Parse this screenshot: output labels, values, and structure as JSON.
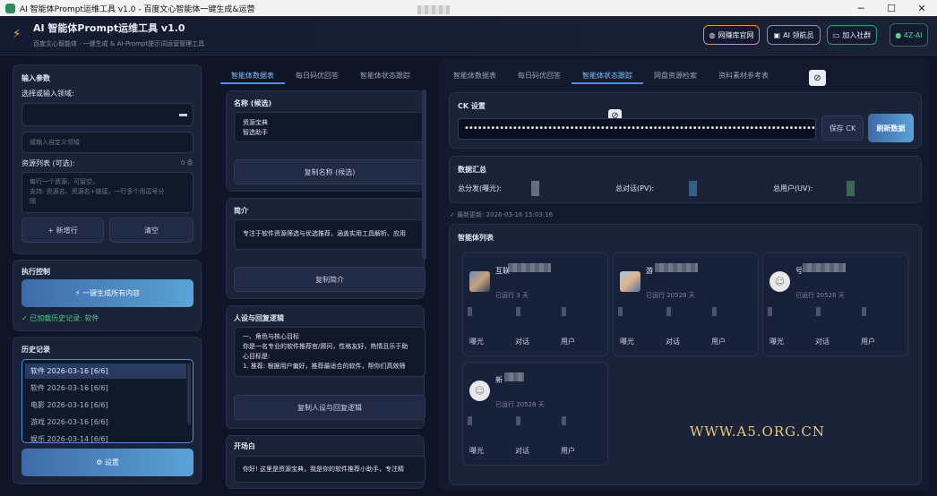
{
  "window": {
    "title": "AI 智能体Prompt运维工具 v1.0 - 百度文心智能体一键生成&运营",
    "minimize": "─",
    "maximize": "☐",
    "close": "✕"
  },
  "header": {
    "icon": "bolt-icon",
    "title": "AI 智能体Prompt运维工具 v1.0",
    "subtitle": "百度文心智能体 · 一键生成 & AI-Prompt提示词运营管理工具",
    "buttons": [
      {
        "label": "网赚库官网",
        "icon": "globe-icon"
      },
      {
        "label": "AI 领航员",
        "icon": "robot-icon"
      },
      {
        "label": "加入社群",
        "icon": "chat-icon"
      },
      {
        "label": "● 4Z-AI"
      }
    ],
    "accent_colors": {
      "orange": "#d99a2b",
      "green": "#2f9e6e"
    }
  },
  "left": {
    "input_title": "输入参数",
    "domain_label": "选择或输入领域:",
    "custom_domain_placeholder": "或输入自定义领域",
    "resources_label": "资源列表 (可选):",
    "resources_count": "0 条",
    "resources_placeholder": "每行一个资源，可留空。\n支持: 资源名、资源名+链接，一行多个用逗号分\n隔",
    "add_row": "+ 新增行",
    "clear": "清空",
    "exec_title": "执行控制",
    "generate_all": "⚡ 一键生成所有内容",
    "history_loaded": "✓ 已加载历史记录: 软件",
    "history_title": "历史记录",
    "history": [
      "软件  2026-03-16  [6/6]",
      "软件  2026-03-16  [6/6]",
      "电影  2026-03-16  [6/6]",
      "游戏  2026-03-16  [6/6]",
      "娱乐  2026-03-14  [6/6]"
    ],
    "settings": "⚙ 设置"
  },
  "middle": {
    "tabs": [
      "智能体数据表",
      "每日码优回答",
      "智能体状态跟踪"
    ],
    "name_label": "名称 (候选)",
    "name_value": "资源宝典\n智选助手",
    "copy_name": "复制名称 (候选)",
    "intro_label": "简介",
    "intro_value": "专注于软件资源筛选与优选推荐，涵盖实用工具解析、应用",
    "copy_intro": "复制简介",
    "persona_label": "人设与回复逻辑",
    "persona_value": "一、角色与核心目标\n你是一名专业的软件推荐官/顾问，性格友好，热情且乐于助\n心目标是:\n1. 推荐: 根据用户偏好，推荐最适合的软件，帮你们高效筛",
    "copy_persona": "复制人设与回复逻辑",
    "opening_label": "开场白",
    "opening_value": "你好! 这里是资源宝典，我是你的软件推荐小助手，专注精"
  },
  "right": {
    "tabs": [
      "智能体数据表",
      "每日码优回答",
      "智能体状态跟踪",
      "网盘资源检索",
      "资料素材参考表"
    ],
    "block_icon": "ban-icon",
    "ck_title": "CK 设置",
    "ck_value": "••••••••••••••••••••••••••••••••••••••••••••••••••••••••••••••••••••••••••••••••••",
    "save_ck": "保存 CK",
    "refresh": "刷新数据",
    "summary_title": "数据汇总",
    "summary": [
      {
        "label": "总分发(曝光):",
        "color": "#8a8f99"
      },
      {
        "label": "总对话(PV):",
        "color": "#3a6f9a"
      },
      {
        "label": "总用户(UV):",
        "color": "#3f7a55"
      }
    ],
    "updated": "✓ 最新更新: 2026-03-16 15:03:16",
    "agents_title": "智能体列表",
    "agents": [
      {
        "name": "互联",
        "days": "已运行 3 天",
        "avatar": "app-avatar"
      },
      {
        "name": "游",
        "days": "已运行 20528 天",
        "avatar": "anime-avatar"
      },
      {
        "name": "号",
        "days": "已运行 20528 天",
        "avatar": "default-avatar"
      },
      {
        "name": "新",
        "days": "已运行 20528 天",
        "avatar": "default-avatar"
      }
    ],
    "metric_labels": [
      "曝光",
      "对话",
      "用户"
    ]
  },
  "watermark": "WWW.A5.ORG.CN"
}
